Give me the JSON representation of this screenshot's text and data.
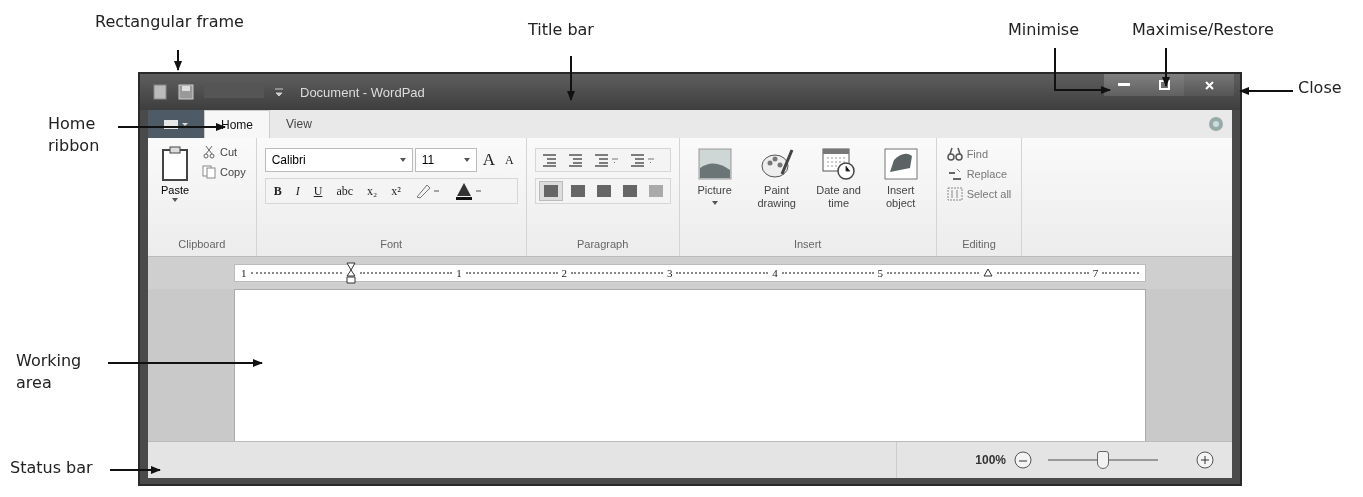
{
  "annotations": [
    {
      "text": "Rectangular frame"
    },
    {
      "text": "Title bar"
    },
    {
      "text": "Minimise"
    },
    {
      "text": "Maximise/Restore"
    },
    {
      "text": "Close"
    },
    {
      "text": "Home ribbon"
    },
    {
      "text": "Working area"
    },
    {
      "text": "Status bar"
    }
  ],
  "window": {
    "title": "Document - WordPad"
  },
  "tabs": [
    {
      "label": "Home",
      "selected": true
    },
    {
      "label": "View",
      "selected": false
    }
  ],
  "ribbon": {
    "clipboard": {
      "label": "Clipboard",
      "paste": "Paste",
      "cut": "Cut",
      "copy": "Copy"
    },
    "font": {
      "label": "Font",
      "font_name": "Calibri",
      "font_size": "11",
      "size_buttons": [
        "A",
        "A"
      ],
      "style_buttons": [
        "B",
        "I",
        "U",
        "abc",
        "x₂",
        "x²"
      ]
    },
    "paragraph": {
      "label": "Paragraph"
    },
    "insert": {
      "label": "Insert",
      "items": [
        {
          "kind": "picture",
          "label": "Picture"
        },
        {
          "kind": "paint",
          "label": "Paint drawing"
        },
        {
          "kind": "datetime",
          "label": "Date and time"
        },
        {
          "kind": "object",
          "label": "Insert object"
        }
      ]
    },
    "editing": {
      "label": "Editing",
      "items": [
        {
          "kind": "find",
          "label": "Find"
        },
        {
          "kind": "replace",
          "label": "Replace"
        },
        {
          "kind": "select",
          "label": "Select all"
        }
      ]
    }
  },
  "ruler": {
    "labels": [
      "1",
      "1",
      "2",
      "3",
      "4",
      "5",
      "7"
    ]
  },
  "status_bar": {
    "zoom": "100%",
    "zoom_slider": {
      "level": 0.5
    }
  }
}
